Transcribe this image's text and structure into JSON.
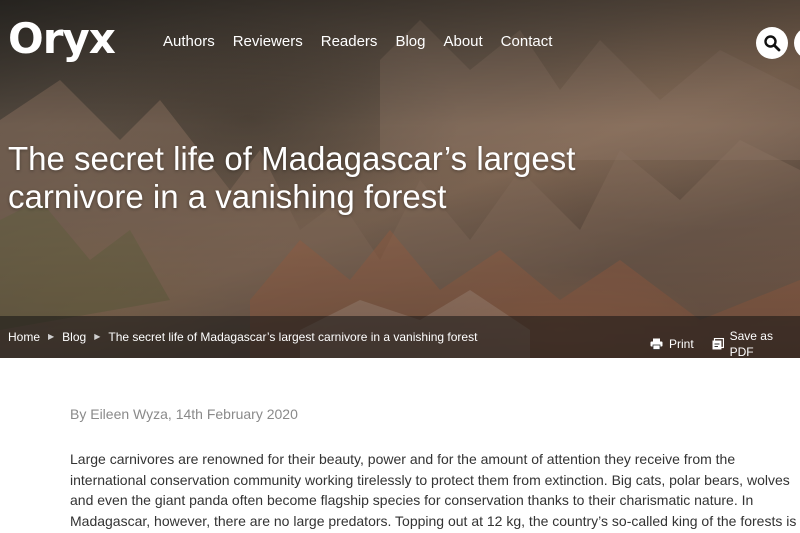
{
  "site": {
    "logo": "Oryx"
  },
  "nav": {
    "items": [
      "Authors",
      "Reviewers",
      "Readers",
      "Blog",
      "About",
      "Contact"
    ]
  },
  "article": {
    "title": "The secret life of Madagascar’s largest carnivore in a vanishing forest",
    "byline": "By Eileen Wyza, 14th February 2020",
    "paragraph": "Large carnivores are renowned for their beauty, power and for the amount of attention they receive from the international conservation community working tirelessly to protect them from extinction. Big cats, polar bears, wolves and even the giant panda often become flagship species for conservation thanks to their charismatic nature. In Madagascar, however, there are no large predators. Topping out at 12 kg, the country’s so-called king of the forests is a cat-like carnivore known as the fosa."
  },
  "breadcrumb": {
    "home": "Home",
    "blog": "Blog",
    "current": "The secret life of Madagascar’s largest carnivore in a vanishing forest"
  },
  "actions": {
    "print": "Print",
    "save_pdf": "Save as PDF"
  },
  "icons": {
    "search": "search-icon",
    "print": "printer-icon",
    "pdf": "pdf-icon",
    "separator": "triangle-right-icon"
  },
  "colors": {
    "byline": "#8a8a8a",
    "body_text": "#333333",
    "header_text": "#ffffff"
  }
}
